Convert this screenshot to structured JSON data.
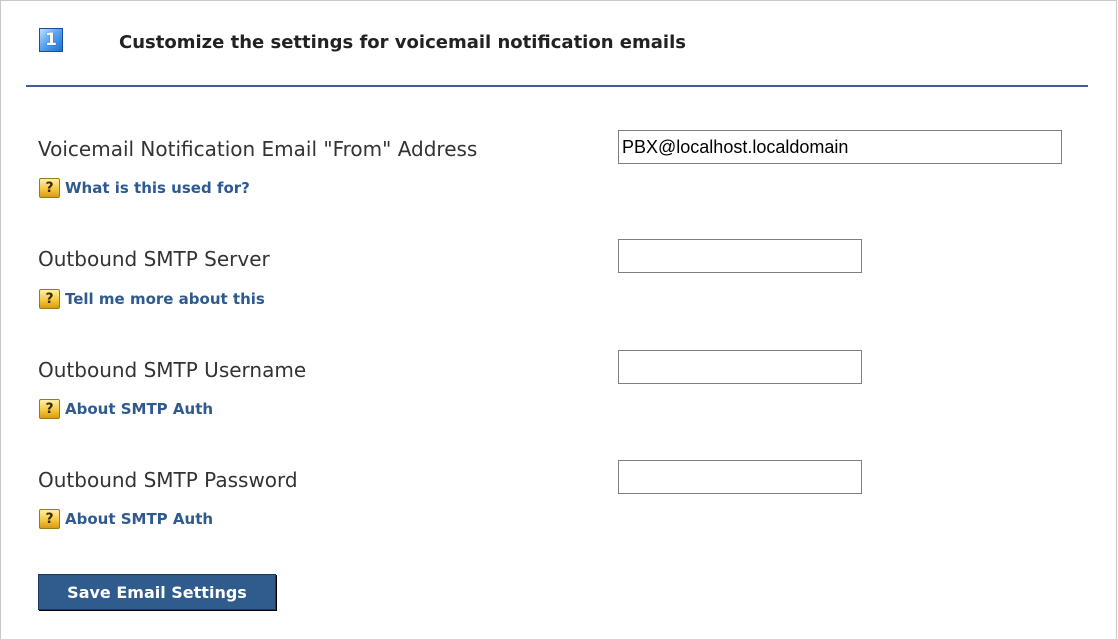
{
  "header": {
    "step_number": "1",
    "title": "Customize the settings for voicemail notification emails"
  },
  "fields": {
    "from_address": {
      "label": "Voicemail Notification Email \"From\" Address",
      "value": "PBX@localhost.localdomain",
      "help_link": "What is this used for?"
    },
    "smtp_server": {
      "label": "Outbound SMTP Server",
      "value": "",
      "help_link": "Tell me more about this"
    },
    "smtp_username": {
      "label": "Outbound SMTP Username",
      "value": "",
      "help_link": "About SMTP Auth"
    },
    "smtp_password": {
      "label": "Outbound SMTP Password",
      "value": "",
      "help_link": "About SMTP Auth"
    }
  },
  "help_icon_glyph": "?",
  "save_button_label": "Save Email Settings",
  "colors": {
    "header_rule": "#3f5f94",
    "link": "#2f5a8f",
    "button_bg": "#2f5b8d"
  }
}
